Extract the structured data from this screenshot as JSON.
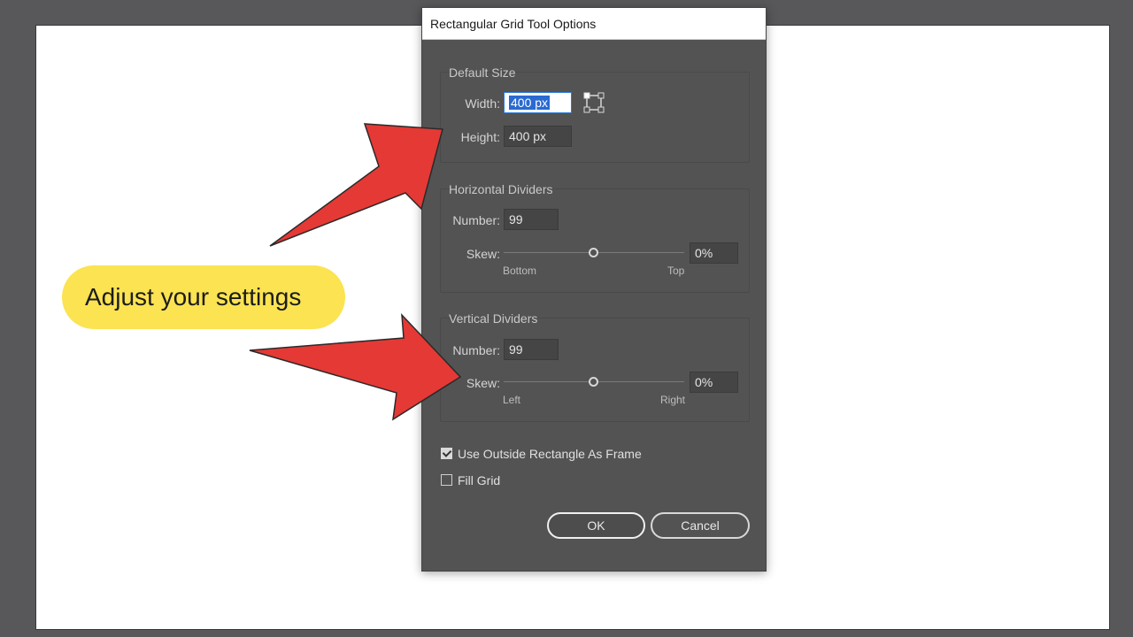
{
  "dialog": {
    "title": "Rectangular Grid Tool Options",
    "default_size": {
      "title": "Default Size",
      "width_label": "Width:",
      "width_value": "400 px",
      "height_label": "Height:",
      "height_value": "400 px",
      "origin_icon": "reference-point-icon"
    },
    "horizontal": {
      "title": "Horizontal Dividers",
      "number_label": "Number:",
      "number_value": "99",
      "skew_label": "Skew:",
      "skew_value": "0%",
      "skew_slider_fraction": 0.5,
      "min_label": "Bottom",
      "max_label": "Top"
    },
    "vertical": {
      "title": "Vertical Dividers",
      "number_label": "Number:",
      "number_value": "99",
      "skew_label": "Skew:",
      "skew_value": "0%",
      "skew_slider_fraction": 0.5,
      "min_label": "Left",
      "max_label": "Right"
    },
    "options": {
      "use_outside_label": "Use Outside Rectangle As Frame",
      "use_outside_checked": true,
      "fill_grid_label": "Fill Grid",
      "fill_grid_checked": false
    },
    "buttons": {
      "ok": "OK",
      "cancel": "Cancel"
    }
  },
  "callout": {
    "text": "Adjust your settings",
    "color": "#fbe352"
  },
  "arrows": {
    "color": "#e53935",
    "outline": "#2a2a2a"
  }
}
